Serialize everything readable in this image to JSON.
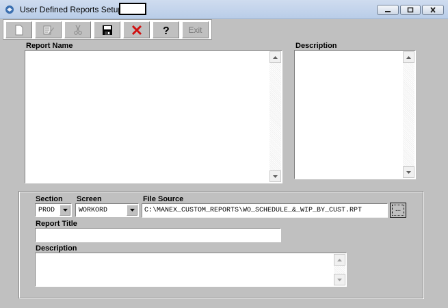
{
  "window": {
    "title": "User Defined Reports Setup"
  },
  "toolbar": {
    "buttons": [
      {
        "name": "new",
        "icon": "new-document-icon"
      },
      {
        "name": "edit",
        "icon": "edit-icon"
      },
      {
        "name": "cut",
        "icon": "scissors-icon"
      },
      {
        "name": "save",
        "icon": "floppy-disk-icon"
      },
      {
        "name": "delete",
        "icon": "red-x-icon"
      },
      {
        "name": "help",
        "icon": "question-mark-icon"
      }
    ],
    "exit_label": "Exit"
  },
  "report_list": {
    "report_name_label": "Report Name",
    "description_label": "Description"
  },
  "details": {
    "section_label": "Section",
    "section_value": "PROD",
    "screen_label": "Screen",
    "screen_value": "WORKORD",
    "file_source_label": "File Source",
    "file_source_value": "C:\\MANEX_CUSTOM_REPORTS\\WO_SCHEDULE_&_WIP_BY_CUST.RPT",
    "browse_label": "...",
    "report_title_label": "Report Title",
    "report_title_value": "",
    "description_label": "Description",
    "description_value": ""
  },
  "colors": {
    "window_bg": "#c0c0c0",
    "titlebar": "#b9cde8",
    "delete_icon": "#d01010"
  }
}
